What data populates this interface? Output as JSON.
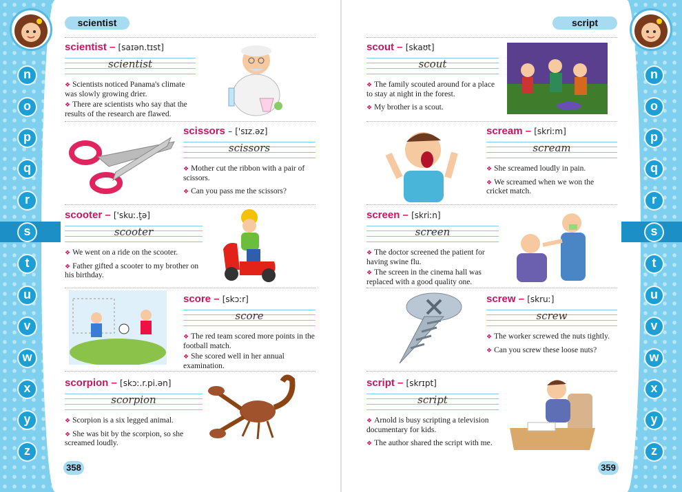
{
  "left_page": {
    "header": "scientist",
    "page_number": "358",
    "entries": [
      {
        "word": "scientist",
        "ipa": "[saɪən.tɪst]",
        "cursive": "scientist",
        "sentences": [
          "Scientists noticed Panama's climate was slowly growing drier.",
          "There are scientists who say that the results of the research are flawed."
        ]
      },
      {
        "word": "scissors",
        "ipa": "['sɪz.əz]",
        "cursive": "scissors",
        "sentences": [
          "Mother cut the ribbon with a pair of scissors.",
          "Can you pass me the scissors?"
        ]
      },
      {
        "word": "scooter",
        "ipa": "['skuː.t̬ə]",
        "cursive": "scooter",
        "sentences": [
          "We went on a ride on the scooter.",
          "Father gifted a scooter to my brother on his birthday."
        ]
      },
      {
        "word": "score",
        "ipa": "[skɔːr]",
        "cursive": "score",
        "sentences": [
          "The red team scored more points in the football match.",
          "She scored well in her annual examination."
        ]
      },
      {
        "word": "scorpion",
        "ipa": "[skɔː.r.pi.ən]",
        "cursive": "scorpion",
        "sentences": [
          "Scorpion is a six legged animal.",
          "She was bit by the scorpion, so she screamed loudly."
        ]
      }
    ]
  },
  "right_page": {
    "header": "script",
    "page_number": "359",
    "entries": [
      {
        "word": "scout",
        "ipa": "[skaʊt]",
        "cursive": "scout",
        "sentences": [
          "The family scouted around for a place to stay at night in the forest.",
          "My brother is a scout."
        ]
      },
      {
        "word": "scream",
        "ipa": "[skriːm]",
        "cursive": "scream",
        "sentences": [
          "She screamed loudly in pain.",
          "We screamed when we won the cricket match."
        ]
      },
      {
        "word": "screen",
        "ipa": "[skriːn]",
        "cursive": "screen",
        "sentences": [
          "The doctor screened the patient for having swine flu.",
          "The screen in the cinema hall was replaced with a good quality one."
        ]
      },
      {
        "word": "screw",
        "ipa": "[skruː]",
        "cursive": "screw",
        "sentences": [
          "The worker screwed the nuts tightly.",
          "Can you screw these loose nuts?"
        ]
      },
      {
        "word": "script",
        "ipa": "[skrɪpt]",
        "cursive": "script",
        "sentences": [
          "Arnold is busy scripting a television documentary for kids.",
          "The author shared the script with me."
        ]
      }
    ]
  },
  "alphabet": [
    "n",
    "o",
    "p",
    "q",
    "r",
    "s",
    "t",
    "u",
    "v",
    "w",
    "x",
    "y",
    "z"
  ],
  "active_letter": "s",
  "colors": {
    "headword": "#c8155f",
    "rail": "#7fd0ee",
    "letter": "#1d9fd6",
    "active_tab": "#1c8fc6"
  }
}
